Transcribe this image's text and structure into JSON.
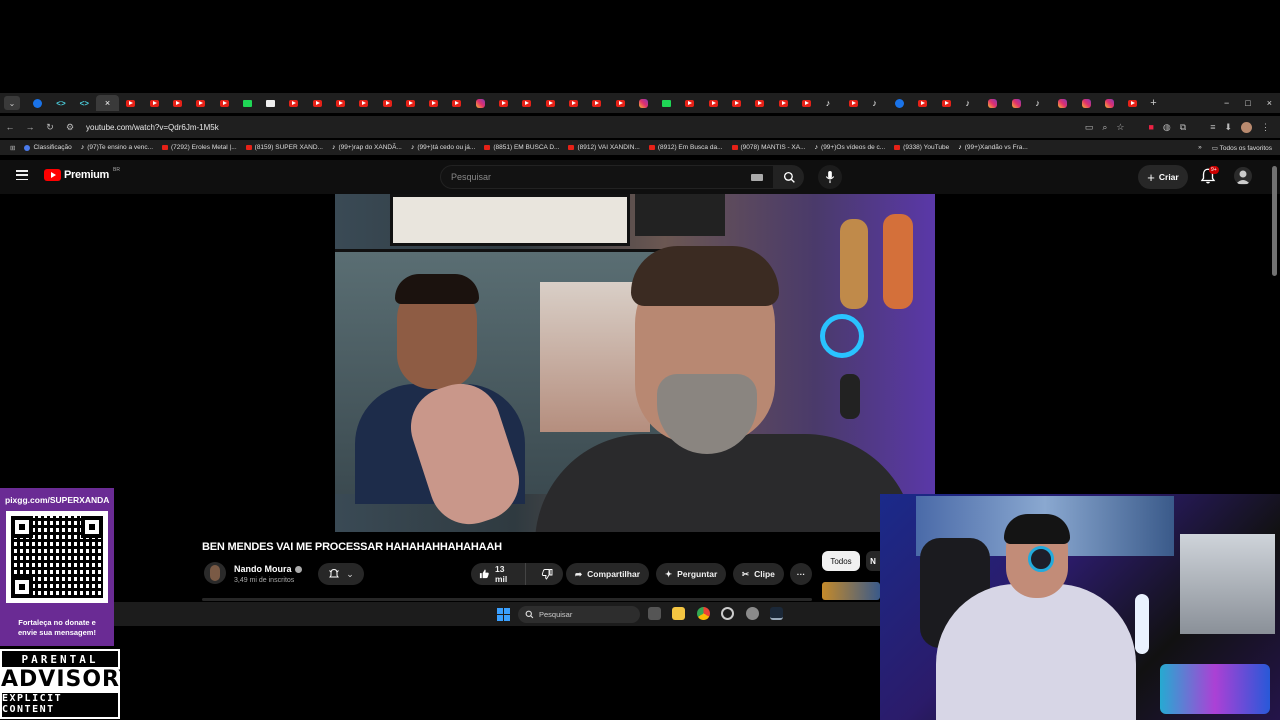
{
  "browser": {
    "active_tab_close": "×",
    "new_tab": "+",
    "window_controls": [
      "−",
      "□",
      "×"
    ],
    "url": "youtube.com/watch?v=Qdr6Jm-1M5k",
    "bookmarks": [
      {
        "icon": "classification-icon",
        "label": "Classificação"
      },
      {
        "icon": "tiktok-icon",
        "label": "(97)Te ensino a venc..."
      },
      {
        "icon": "youtube-icon",
        "label": "(7292) Eroles Metal |..."
      },
      {
        "icon": "youtube-icon",
        "label": "(8159) SUPER XAND..."
      },
      {
        "icon": "tiktok-icon",
        "label": "(99+)rap do XANDÃ..."
      },
      {
        "icon": "tiktok-icon",
        "label": "(99+)tá cedo ou já..."
      },
      {
        "icon": "youtube-icon",
        "label": "(8851) EM BUSCA D..."
      },
      {
        "icon": "youtube-icon",
        "label": "(8912) VAI XANDIN..."
      },
      {
        "icon": "youtube-icon",
        "label": "(8912) Em Busca da..."
      },
      {
        "icon": "youtube-icon",
        "label": "(9078) MANTIS - XA..."
      },
      {
        "icon": "tiktok-icon",
        "label": "(99+)Os vídeos de c..."
      },
      {
        "icon": "youtube-icon",
        "label": "(9338) YouTube"
      },
      {
        "icon": "tiktok-icon",
        "label": "(99+)Xandão vs Fra..."
      }
    ],
    "bookmarks_more": "»",
    "all_bookmarks": "Todos os favoritos"
  },
  "youtube": {
    "logo_text": "Premium",
    "logo_region": "BR",
    "search_placeholder": "Pesquisar",
    "create_label": "Criar",
    "notifications_badge": "9+",
    "video_title": "BEN MENDES VAI ME PROCESSAR HAHAHAHHAHAHAAH",
    "channel_name": "Nando Moura",
    "subscribers": "3,49 mi de inscritos",
    "likes": "13 mil",
    "share_label": "Compartilhar",
    "ask_label": "Perguntar",
    "clip_label": "Clipe",
    "more_label": "···",
    "filter_all": "Todos",
    "filter_next": "N"
  },
  "taskbar": {
    "search_label": "Pesquisar"
  },
  "overlay": {
    "pix_url": "pixgg.com/SUPERXANDA",
    "pix_message_line1": "Fortaleça no donate e",
    "pix_message_line2": "envie sua mensagem!",
    "advisory_line1": "PARENTAL",
    "advisory_line2": "ADVISORY",
    "advisory_line3": "EXPLICIT CONTENT"
  },
  "colors": {
    "youtube_red": "#ff0000",
    "pix_purple": "#6a2b94",
    "background": "#0f0f0f"
  }
}
